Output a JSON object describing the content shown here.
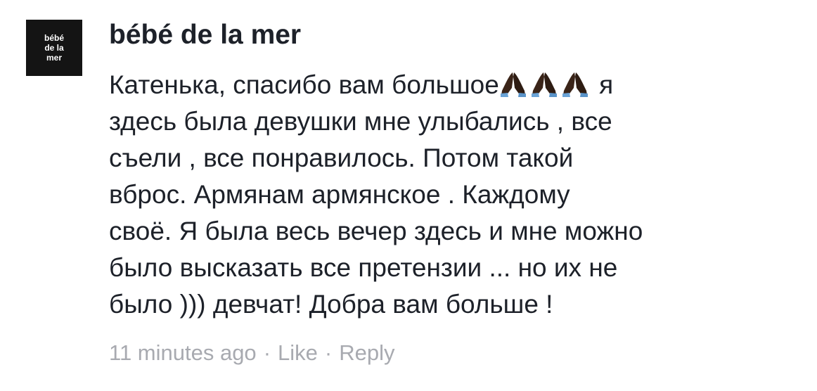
{
  "comment": {
    "avatar": {
      "line1": "bébé",
      "line2": "de la",
      "line3": "mer"
    },
    "author": "bébé de la mer",
    "body": {
      "line1_before": "Катенька, спасибо вам большое",
      "emoji_icon": "folded-hands-icon",
      "line1_after": " я",
      "line2": "здесь была девушки мне улыбались , все",
      "line3": "съели , все понравилось. Потом такой",
      "line4": "вброс. Армянам армянское . Каждому",
      "line5": "своё. Я была весь вечер здесь и мне можно",
      "line6": "было высказать все претензии ...  но их не",
      "line7": "было ))) девчат! Добра вам больше !"
    },
    "meta": {
      "time": "11 minutes ago",
      "separator": "·",
      "like": "Like",
      "reply": "Reply"
    }
  },
  "colors": {
    "text": "#1d2129",
    "meta": "#a8aab0",
    "avatar_bg": "#141414"
  }
}
